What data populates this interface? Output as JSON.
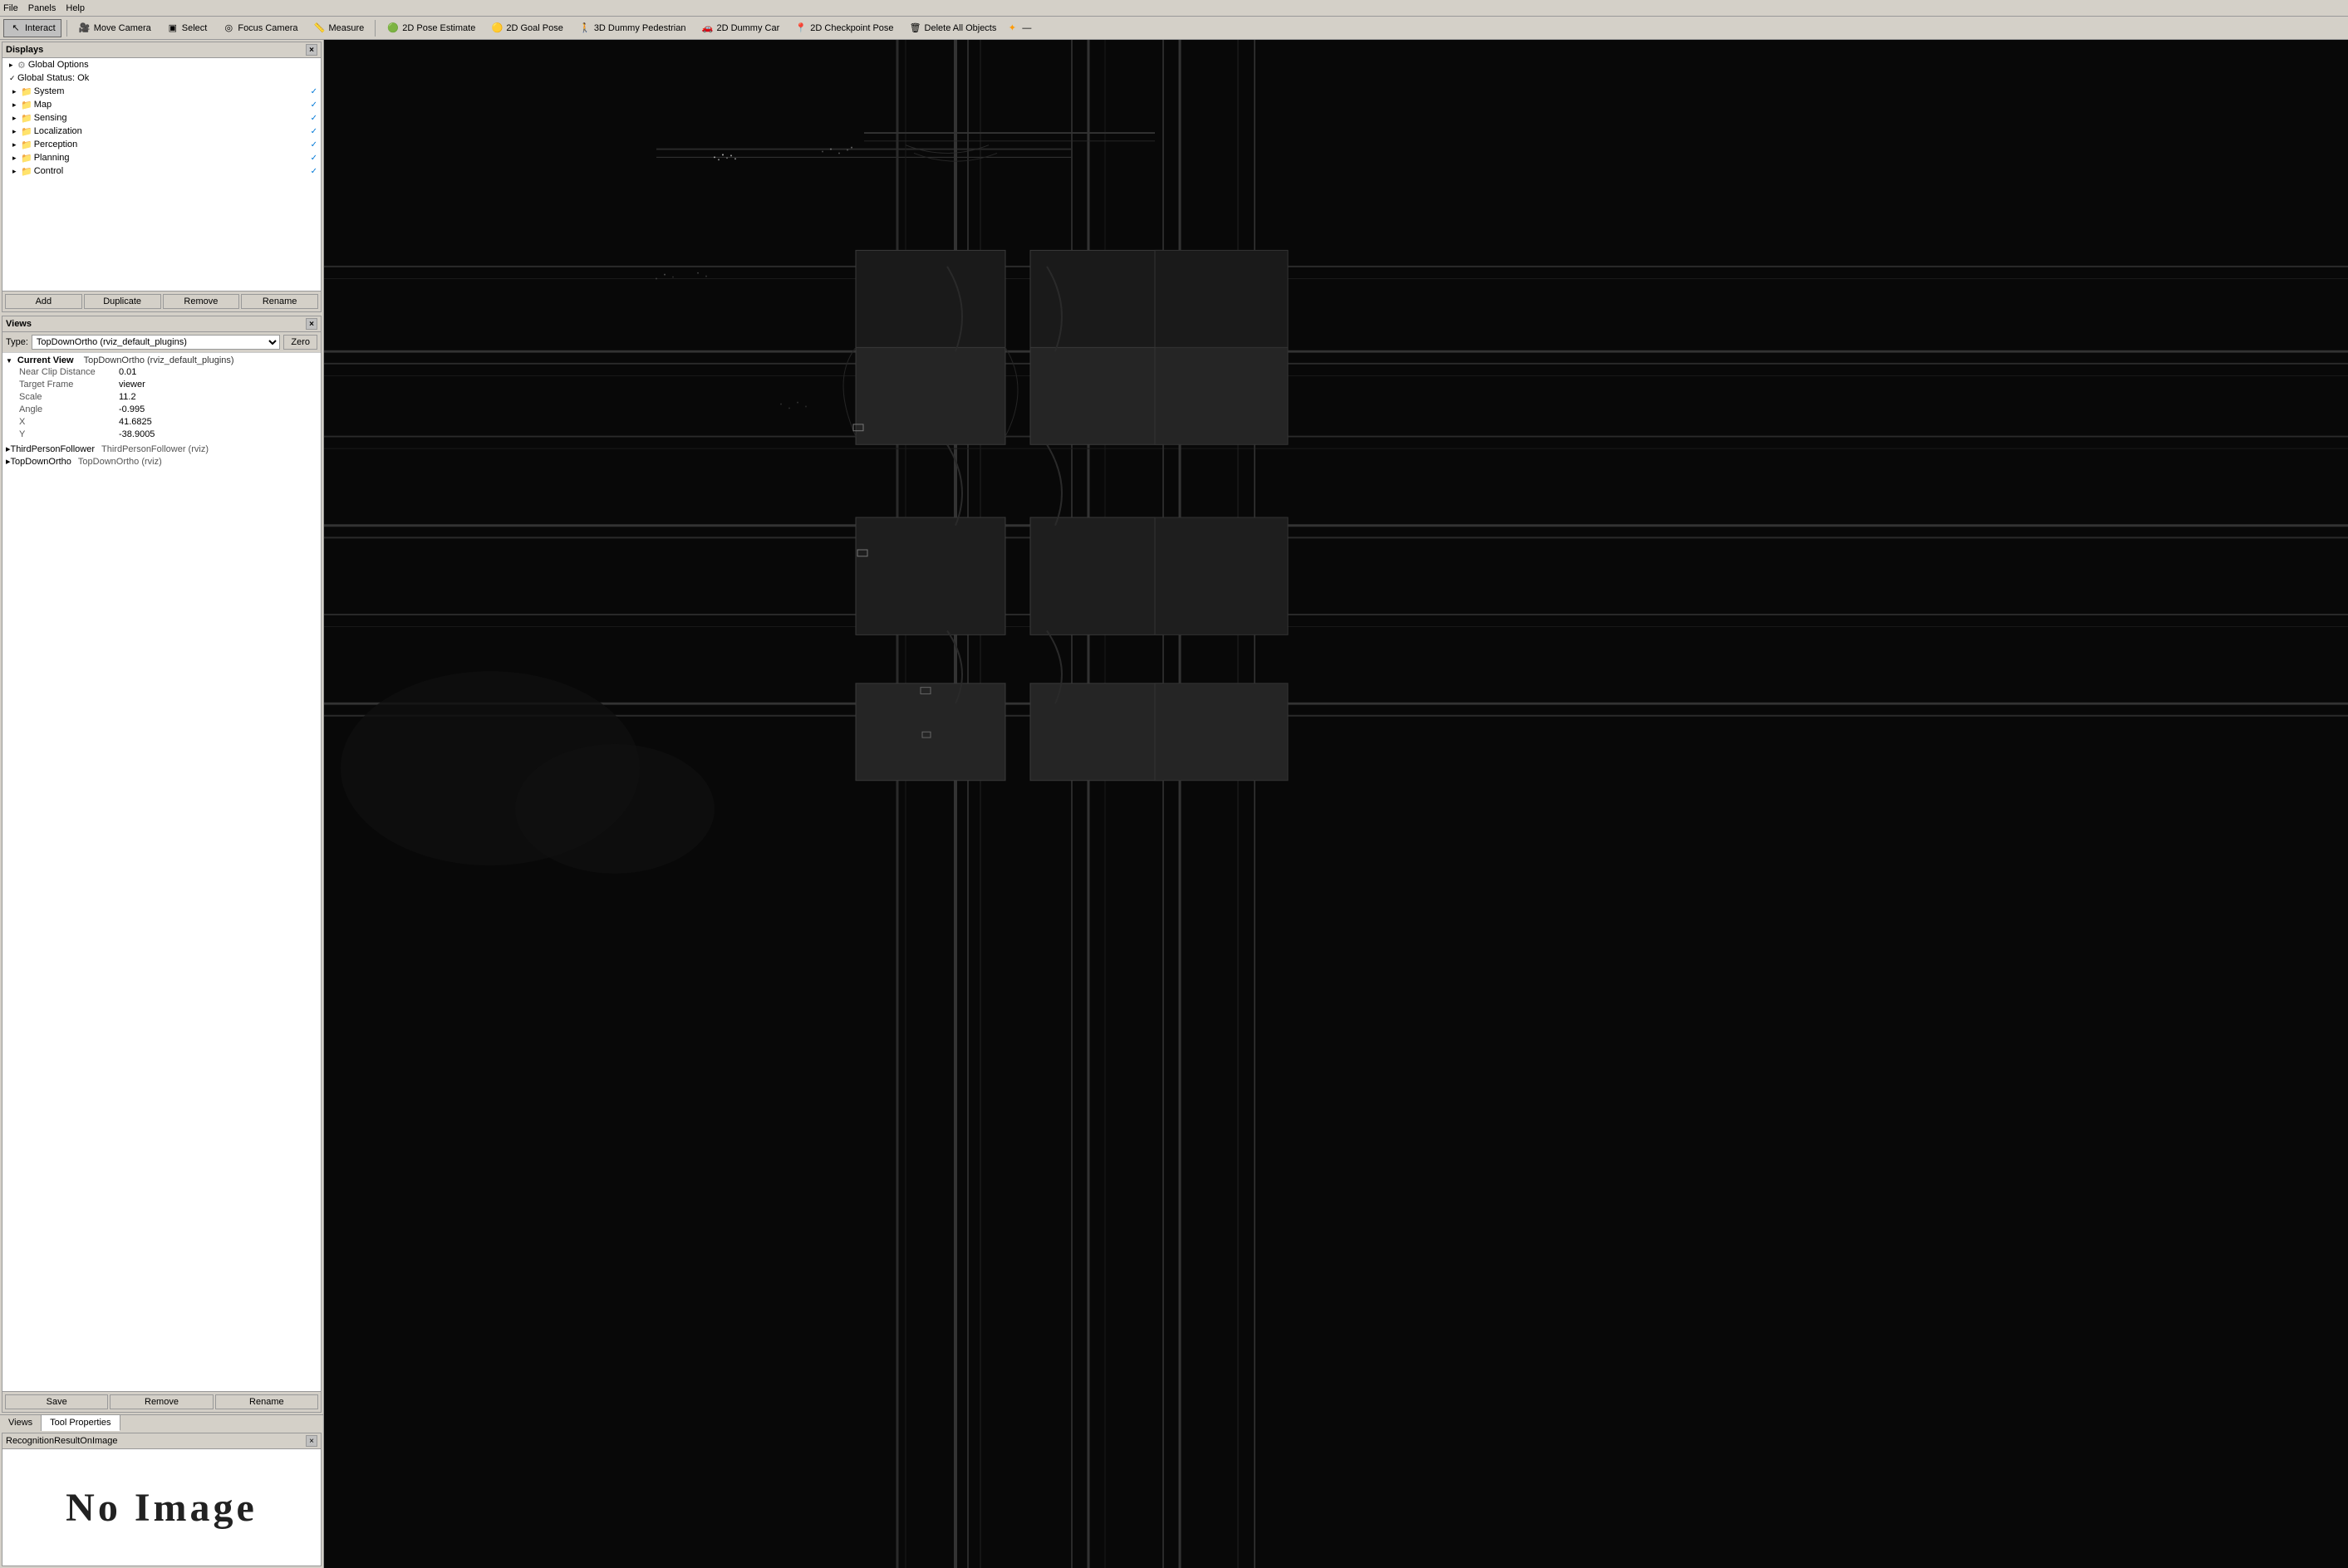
{
  "menubar": {
    "items": [
      "File",
      "Panels",
      "Help"
    ]
  },
  "toolbar": {
    "interact_label": "Interact",
    "move_camera_label": "Move Camera",
    "select_label": "Select",
    "focus_camera_label": "Focus Camera",
    "measure_label": "Measure",
    "pose_estimate_label": "2D Pose Estimate",
    "goal_pose_label": "2D Goal Pose",
    "dummy_pedestrian_label": "3D Dummy Pedestrian",
    "dummy_car_label": "2D Dummy Car",
    "checkpoint_pose_label": "2D Checkpoint Pose",
    "delete_all_label": "Delete All Objects"
  },
  "displays_panel": {
    "title": "Displays",
    "items": [
      {
        "label": "Global Options",
        "type": "option",
        "indent": 1,
        "checked": false
      },
      {
        "label": "Global Status: Ok",
        "type": "status",
        "indent": 1,
        "checked": true
      },
      {
        "label": "System",
        "type": "folder",
        "indent": 2,
        "checked": true
      },
      {
        "label": "Map",
        "type": "folder",
        "indent": 2,
        "checked": true
      },
      {
        "label": "Sensing",
        "type": "folder",
        "indent": 2,
        "checked": true
      },
      {
        "label": "Localization",
        "type": "folder",
        "indent": 2,
        "checked": true
      },
      {
        "label": "Perception",
        "type": "folder",
        "indent": 2,
        "checked": true
      },
      {
        "label": "Planning",
        "type": "folder",
        "indent": 2,
        "checked": true
      },
      {
        "label": "Control",
        "type": "folder",
        "indent": 2,
        "checked": true
      }
    ],
    "buttons": [
      "Add",
      "Duplicate",
      "Remove",
      "Rename"
    ]
  },
  "views_panel": {
    "title": "Views",
    "type_label": "Type:",
    "type_value": "TopDownOrtho (rviz_default_plugins)",
    "zero_label": "Zero",
    "current_view": {
      "header": "Current View",
      "plugin": "TopDownOrtho (rviz_default_plugins)",
      "properties": [
        {
          "name": "Near Clip Distance",
          "value": "0.01"
        },
        {
          "name": "Target Frame",
          "value": "viewer"
        },
        {
          "name": "Scale",
          "value": "11.2"
        },
        {
          "name": "Angle",
          "value": "-0.995"
        },
        {
          "name": "X",
          "value": "41.6825"
        },
        {
          "name": "Y",
          "value": "-38.9005"
        }
      ]
    },
    "saved_views": [
      {
        "label": "ThirdPersonFollower",
        "plugin": "ThirdPersonFollower (rviz)"
      },
      {
        "label": "TopDownOrtho",
        "plugin": "TopDownOrtho (rviz)"
      }
    ],
    "buttons": [
      "Save",
      "Remove",
      "Rename"
    ]
  },
  "bottom_tabs": [
    "Views",
    "Tool Properties"
  ],
  "image_panel": {
    "title": "RecognitionResultOnImage",
    "no_image_text": "No Image"
  },
  "viewport": {
    "background_color": "#080808"
  }
}
